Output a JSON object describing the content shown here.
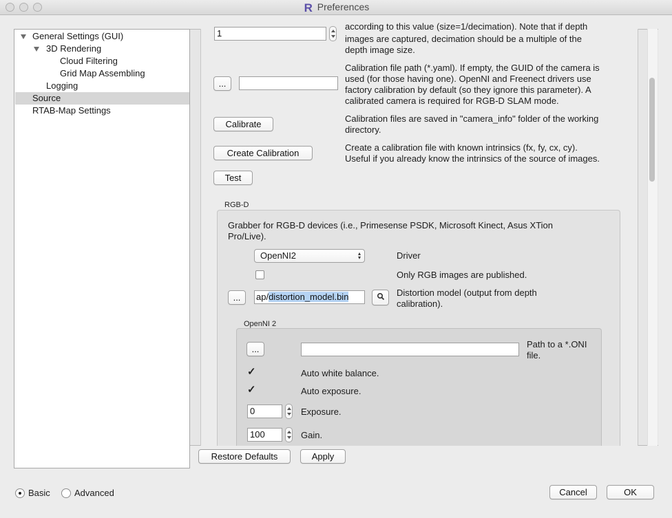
{
  "window": {
    "title": "Preferences",
    "logo_letter": "R"
  },
  "tree": {
    "items": [
      {
        "label": "General Settings (GUI)"
      },
      {
        "label": "3D Rendering"
      },
      {
        "label": "Cloud Filtering"
      },
      {
        "label": "Grid Map Assembling"
      },
      {
        "label": "Logging"
      },
      {
        "label": "Source"
      },
      {
        "label": "RTAB-Map Settings"
      }
    ]
  },
  "source": {
    "decimation_value": "1",
    "decimation_desc": [
      "according to this value (size=1/decimation). Note that if depth",
      "images are captured, decimation should be a multiple of the",
      "depth image size."
    ],
    "calib_path_button": "...",
    "calib_path_value": "",
    "calib_path_desc": [
      "Calibration file path (*.yaml). If empty, the GUID of the camera is",
      "used (for those having one). OpenNI and Freenect drivers use",
      "factory calibration by default (so they ignore this parameter). A",
      "calibrated camera is required for RGB-D SLAM mode."
    ],
    "calibrate_button": "Calibrate",
    "calibrate_desc": [
      "Calibration files are saved in \"camera_info\" folder of the working",
      "directory."
    ],
    "create_calibration_button": "Create Calibration",
    "create_calibration_desc": [
      "Create a calibration file with known intrinsics (fx, fy, cx, cy).",
      "Useful if you already know the intrinsics of the source of images."
    ],
    "test_button": "Test"
  },
  "rgbd": {
    "group_title": "RGB-D",
    "desc": [
      "Grabber for RGB-D devices (i.e., Primesense PSDK, Microsoft Kinect, Asus XTion",
      "Pro/Live)."
    ],
    "driver_value": "OpenNI2",
    "driver_label": "Driver",
    "only_rgb_label": "Only RGB images are published.",
    "only_rgb_checked": false,
    "distortion_button": "...",
    "distortion_prefix": "ap/",
    "distortion_selected": "distortion_model.bin",
    "distortion_desc": [
      "Distortion model (output from depth",
      "calibration)."
    ]
  },
  "openni2": {
    "group_title": "OpenNI 2",
    "oni_button": "...",
    "oni_path_value": "",
    "oni_desc": [
      "Path to a *.ONI",
      "file."
    ],
    "auto_wb_label": "Auto white balance.",
    "auto_wb_checked": true,
    "auto_exposure_label": "Auto exposure.",
    "auto_exposure_checked": true,
    "exposure_value": "0",
    "exposure_label": "Exposure.",
    "gain_value": "100",
    "gain_label": "Gain."
  },
  "footer": {
    "restore_defaults": "Restore Defaults",
    "apply": "Apply",
    "mode_basic": "Basic",
    "mode_advanced": "Advanced",
    "mode_selected": "Basic",
    "cancel": "Cancel",
    "ok": "OK"
  },
  "icons": {
    "check_glyph": "✓",
    "search_glyph": "🔍",
    "select_arrows": "▲▼"
  }
}
